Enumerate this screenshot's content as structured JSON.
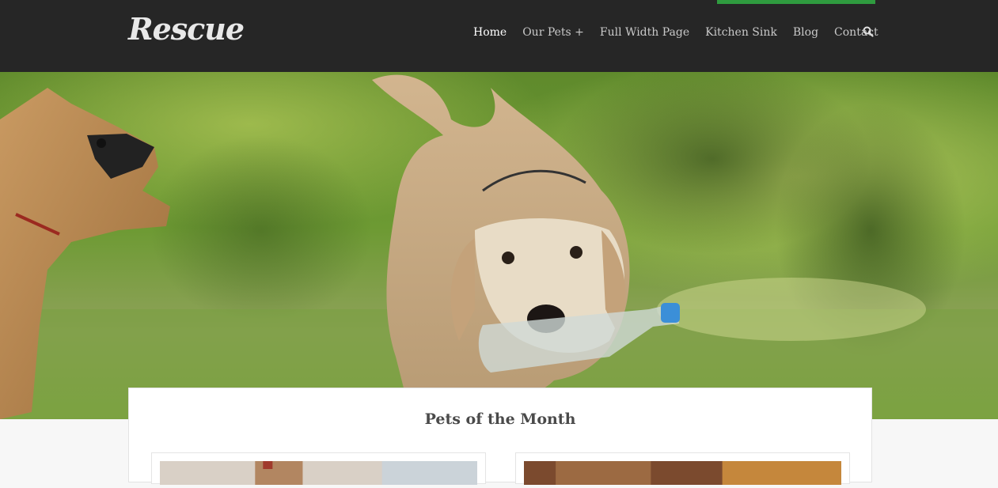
{
  "header": {
    "logo": "Rescue",
    "nav": [
      "Home",
      "Our Pets +",
      "Full Width Page",
      "Kitchen Sink",
      "Blog",
      "Contact"
    ],
    "active_nav": "Home",
    "accent_color": "#2f9b3f",
    "search_icon": "search-icon"
  },
  "hero": {
    "image": "dogs-playing-in-grass"
  },
  "featured": {
    "title": "Pets of the Month",
    "pets": [
      {
        "image": "pet-photo-1"
      },
      {
        "image": "pet-photo-2"
      }
    ]
  }
}
